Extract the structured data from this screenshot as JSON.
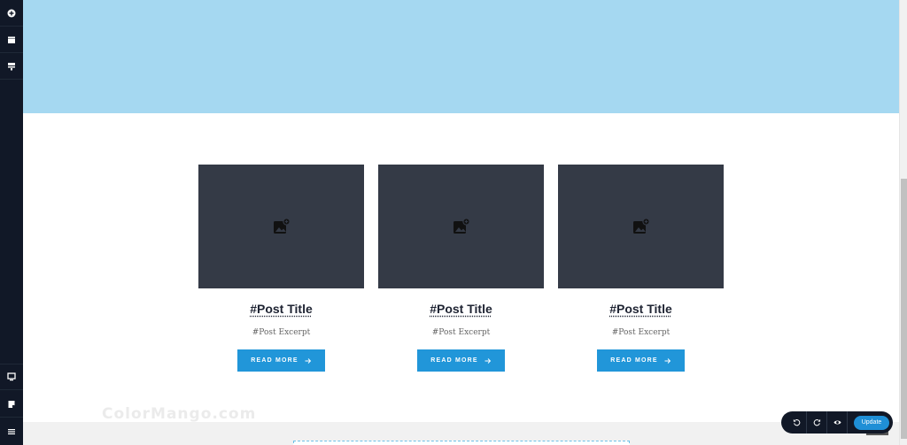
{
  "sidebar": {
    "icons": [
      "plus-circle-icon",
      "folder-icon",
      "layout-icon",
      "desktop-icon",
      "note-icon",
      "hamburger-menu-icon"
    ]
  },
  "posts": [
    {
      "title": "#Post Title",
      "excerpt": "#Post Excerpt",
      "button_label": "READ MORE"
    },
    {
      "title": "#Post Title",
      "excerpt": "#Post Excerpt",
      "button_label": "READ MORE"
    },
    {
      "title": "#Post Title",
      "excerpt": "#Post Excerpt",
      "button_label": "READ MORE"
    }
  ],
  "watermark": "ColorMango.com",
  "toolbar": {
    "update_label": "Update"
  },
  "colors": {
    "hero": "#a5d8f1",
    "thumb": "#343a46",
    "button": "#2196d9",
    "sidebar": "#111827",
    "title": "#1f2433"
  }
}
